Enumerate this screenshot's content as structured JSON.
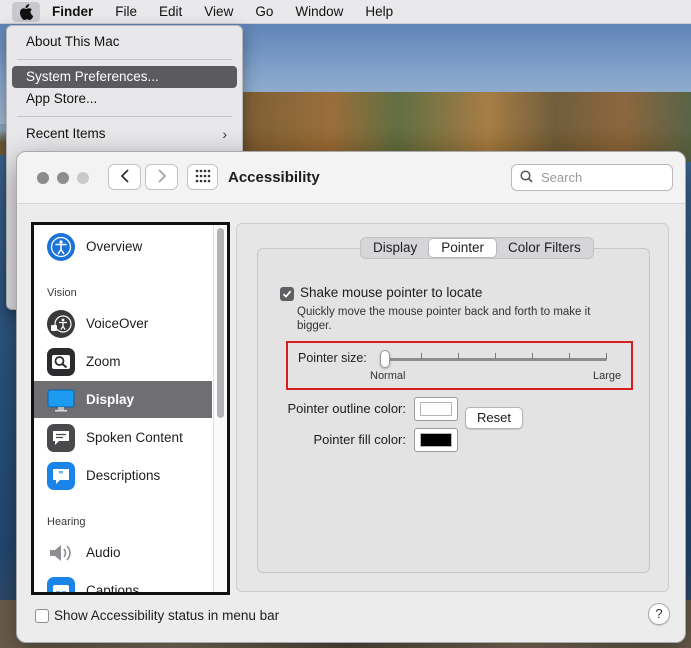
{
  "menubar": {
    "apple_icon": "apple-logo-icon",
    "app_name": "Finder",
    "items": [
      "File",
      "Edit",
      "View",
      "Go",
      "Window",
      "Help"
    ]
  },
  "apple_menu": {
    "about": "About This Mac",
    "system_preferences": "System Preferences...",
    "app_store": "App Store...",
    "recent_items": "Recent Items",
    "recent_items_chevron": "›"
  },
  "window": {
    "title": "Accessibility",
    "search_placeholder": "Search",
    "back_icon": "chevron-left-icon",
    "forward_icon": "chevron-right-icon",
    "grid_icon": "show-all-grid-icon"
  },
  "sidebar": {
    "overview": "Overview",
    "vision_header": "Vision",
    "voiceover": "VoiceOver",
    "zoom": "Zoom",
    "display": "Display",
    "spoken_content": "Spoken Content",
    "descriptions": "Descriptions",
    "hearing_header": "Hearing",
    "audio": "Audio",
    "captions": "Captions",
    "selected": "Display"
  },
  "tabs": {
    "display": "Display",
    "pointer": "Pointer",
    "color_filters": "Color Filters",
    "selected": "Pointer"
  },
  "pointer": {
    "shake_label": "Shake mouse pointer to locate",
    "shake_checked": true,
    "shake_desc": "Quickly move the mouse pointer back and forth to make it bigger.",
    "size_label": "Pointer size:",
    "size_min_label": "Normal",
    "size_max_label": "Large",
    "size_value": 0,
    "outline_label": "Pointer outline color:",
    "outline_color": "#ffffff",
    "fill_label": "Pointer fill color:",
    "fill_color": "#000000",
    "reset_label": "Reset"
  },
  "footer": {
    "status_label": "Show Accessibility status in menu bar",
    "status_checked": false,
    "help_label": "?"
  },
  "colors": {
    "highlight_box": "#d62020",
    "sidebar_selected": "#6f6f73"
  }
}
